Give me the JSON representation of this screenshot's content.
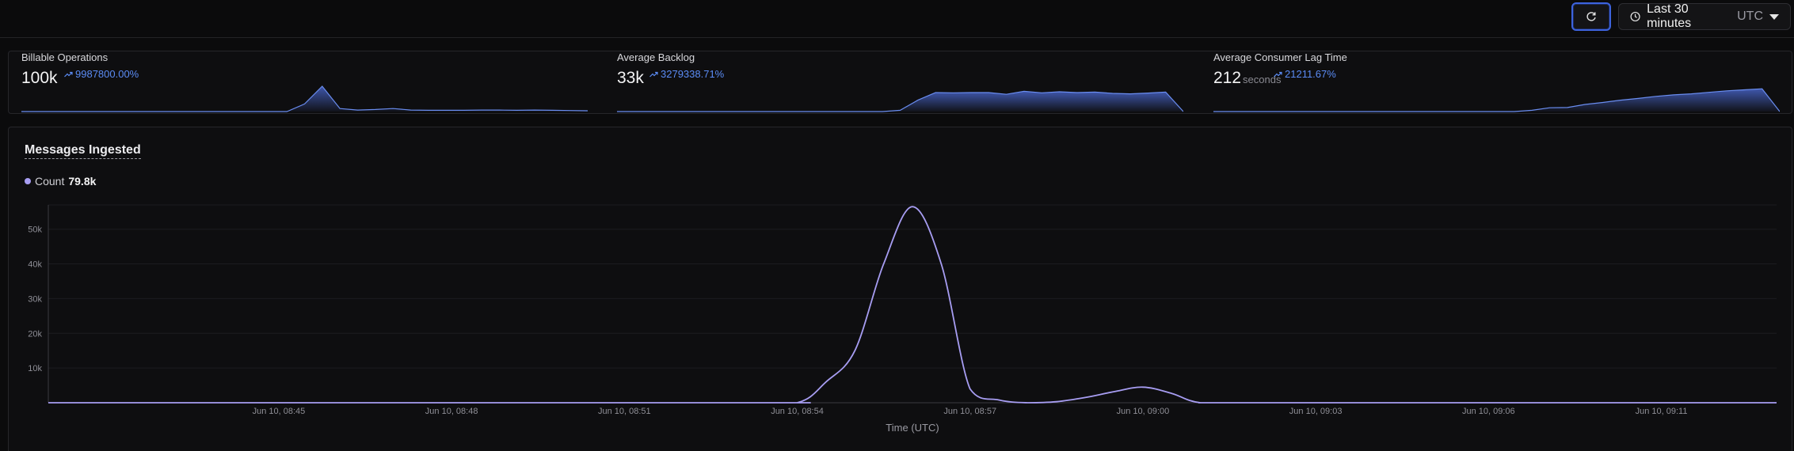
{
  "toolbar": {
    "refresh_icon": "refresh-icon",
    "range_icon": "clock-icon",
    "range_label": "Last 30 minutes",
    "range_timezone": "UTC",
    "dropdown_icon": "caret-down-icon"
  },
  "stats": [
    {
      "title": "Billable Operations",
      "value": "100k",
      "unit": "",
      "delta": "9987800.00%",
      "spark": [
        0,
        0,
        0,
        0,
        0,
        0,
        0,
        0,
        0,
        0,
        0,
        0,
        0,
        0,
        0,
        0,
        0.3,
        1,
        0.12,
        0.06,
        0.08,
        0.12,
        0.06,
        0.05,
        0.05,
        0.05,
        0.06,
        0.06,
        0.05,
        0.06,
        0.05,
        0.04,
        0.03
      ]
    },
    {
      "title": "Average Backlog",
      "value": "33k",
      "unit": "",
      "delta": "3279338.71%",
      "spark": [
        0,
        0,
        0,
        0,
        0,
        0,
        0,
        0,
        0,
        0,
        0,
        0,
        0,
        0,
        0,
        0,
        0.05,
        0.45,
        0.75,
        0.74,
        0.75,
        0.75,
        0.68,
        0.8,
        0.74,
        0.78,
        0.75,
        0.77,
        0.72,
        0.7,
        0.73,
        0.77,
        0
      ]
    },
    {
      "title": "Average Consumer Lag Time",
      "value": "212",
      "unit": "seconds",
      "delta": "21211.67%",
      "spark": [
        0,
        0,
        0,
        0,
        0,
        0,
        0,
        0,
        0,
        0,
        0,
        0,
        0,
        0,
        0,
        0,
        0,
        0,
        0.05,
        0.15,
        0.16,
        0.28,
        0.36,
        0.45,
        0.52,
        0.6,
        0.66,
        0.7,
        0.76,
        0.82,
        0.86,
        0.9,
        0
      ]
    }
  ],
  "colors": {
    "accent": "#3d63dd",
    "delta": "#5b8cf5",
    "series": "#a79df2"
  },
  "main": {
    "title": "Messages Ingested",
    "legend_label": "Count",
    "legend_value": "79.8k"
  },
  "chart_data": {
    "type": "line",
    "title": "Messages Ingested",
    "xlabel": "Time (UTC)",
    "ylabel": "",
    "ylim": [
      0,
      57000
    ],
    "ytick_values": [
      10000,
      20000,
      30000,
      40000,
      50000
    ],
    "ytick_labels": [
      "10k",
      "20k",
      "30k",
      "40k",
      "50k"
    ],
    "xtick_labels": [
      "Jun 10, 08:45",
      "Jun 10, 08:48",
      "Jun 10, 08:51",
      "Jun 10, 08:54",
      "Jun 10, 08:57",
      "Jun 10, 09:00",
      "Jun 10, 09:03",
      "Jun 10, 09:06",
      "Jun 10, 09:11"
    ],
    "xtick_positions_min": [
      4,
      7,
      10,
      13,
      16,
      19,
      22,
      25,
      28
    ],
    "x_range_min": [
      0,
      30
    ],
    "series": [
      {
        "name": "Count",
        "x_min": [
          0,
          12,
          13,
          13.5,
          14,
          14.5,
          15,
          15.5,
          16,
          16.5,
          17,
          17.5,
          18,
          18.5,
          19,
          19.5,
          20,
          21,
          30
        ],
        "values": [
          0,
          0,
          0,
          6000,
          15000,
          40000,
          56500,
          40000,
          4000,
          800,
          0,
          300,
          1500,
          3200,
          4500,
          2700,
          0,
          0,
          0
        ]
      }
    ]
  }
}
